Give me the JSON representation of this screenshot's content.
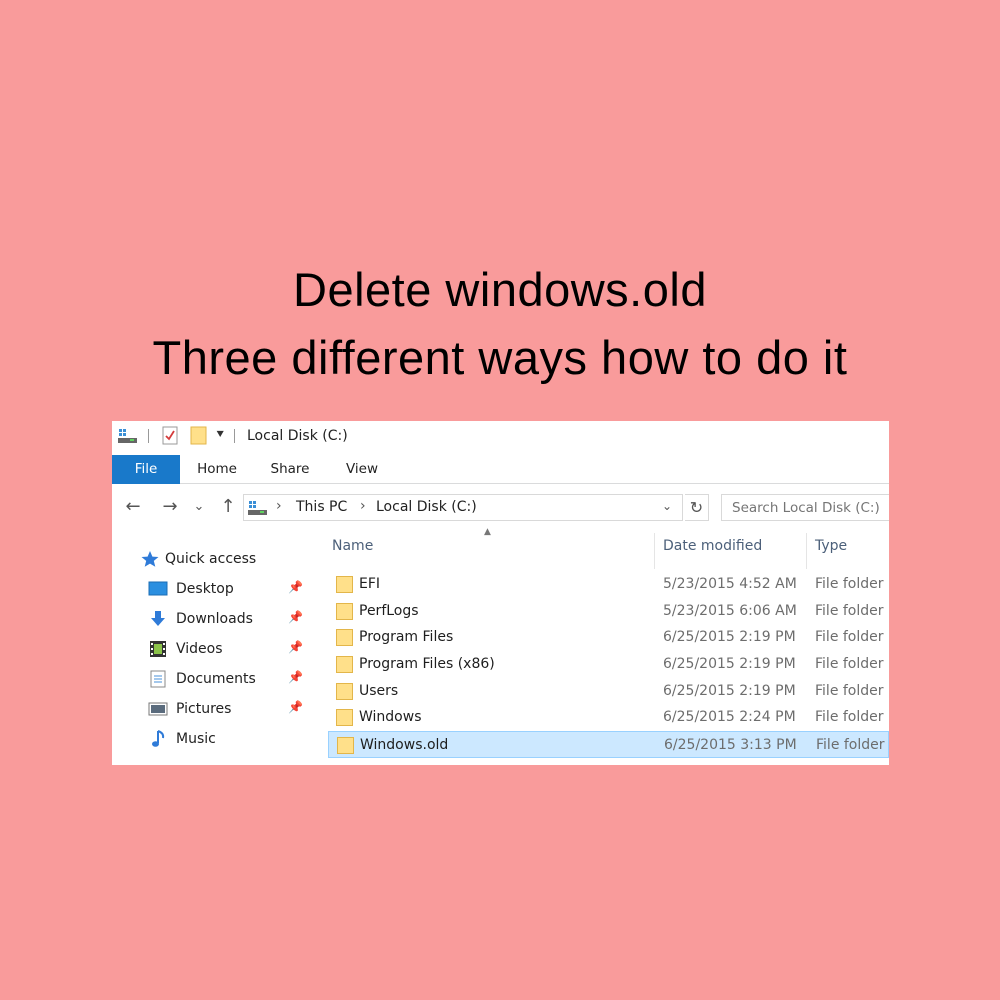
{
  "headline": {
    "line1": "Delete windows.old",
    "line2": "Three different ways how to do it"
  },
  "colors": {
    "background": "#f99b9b",
    "file_tab": "#1979ca",
    "selection": "#cce8ff",
    "folder": "#ffe08a"
  },
  "titlebar": {
    "icons": [
      "drive-icon",
      "properties-checklist-icon",
      "new-folder-icon",
      "customize-dropdown-icon"
    ],
    "title": "Local Disk (C:)"
  },
  "ribbon": {
    "tabs": [
      "File",
      "Home",
      "Share",
      "View"
    ]
  },
  "navigation": {
    "back": "←",
    "forward": "→",
    "recent": "⌄",
    "up": "↑",
    "path": [
      "This PC",
      "Local Disk (C:)"
    ],
    "search_placeholder": "Search Local Disk (C:)"
  },
  "sidebar": {
    "items": [
      {
        "label": "Quick access",
        "icon": "star-icon",
        "pinned": false
      },
      {
        "label": "Desktop",
        "icon": "desktop-icon",
        "pinned": true
      },
      {
        "label": "Downloads",
        "icon": "download-arrow-icon",
        "pinned": true
      },
      {
        "label": "Videos",
        "icon": "film-icon",
        "pinned": true
      },
      {
        "label": "Documents",
        "icon": "document-icon",
        "pinned": true
      },
      {
        "label": "Pictures",
        "icon": "picture-icon",
        "pinned": true
      },
      {
        "label": "Music",
        "icon": "music-note-icon",
        "pinned": false
      }
    ]
  },
  "filelist": {
    "columns": [
      "Name",
      "Date modified",
      "Type"
    ],
    "rows": [
      {
        "name": "EFI",
        "date": "5/23/2015 4:52 AM",
        "type": "File folder"
      },
      {
        "name": "PerfLogs",
        "date": "5/23/2015 6:06 AM",
        "type": "File folder"
      },
      {
        "name": "Program Files",
        "date": "6/25/2015 2:19 PM",
        "type": "File folder"
      },
      {
        "name": "Program Files (x86)",
        "date": "6/25/2015 2:19 PM",
        "type": "File folder"
      },
      {
        "name": "Users",
        "date": "6/25/2015 2:19 PM",
        "type": "File folder"
      },
      {
        "name": "Windows",
        "date": "6/25/2015 2:24 PM",
        "type": "File folder"
      },
      {
        "name": "Windows.old",
        "date": "6/25/2015 3:13 PM",
        "type": "File folder",
        "selected": true
      }
    ]
  }
}
